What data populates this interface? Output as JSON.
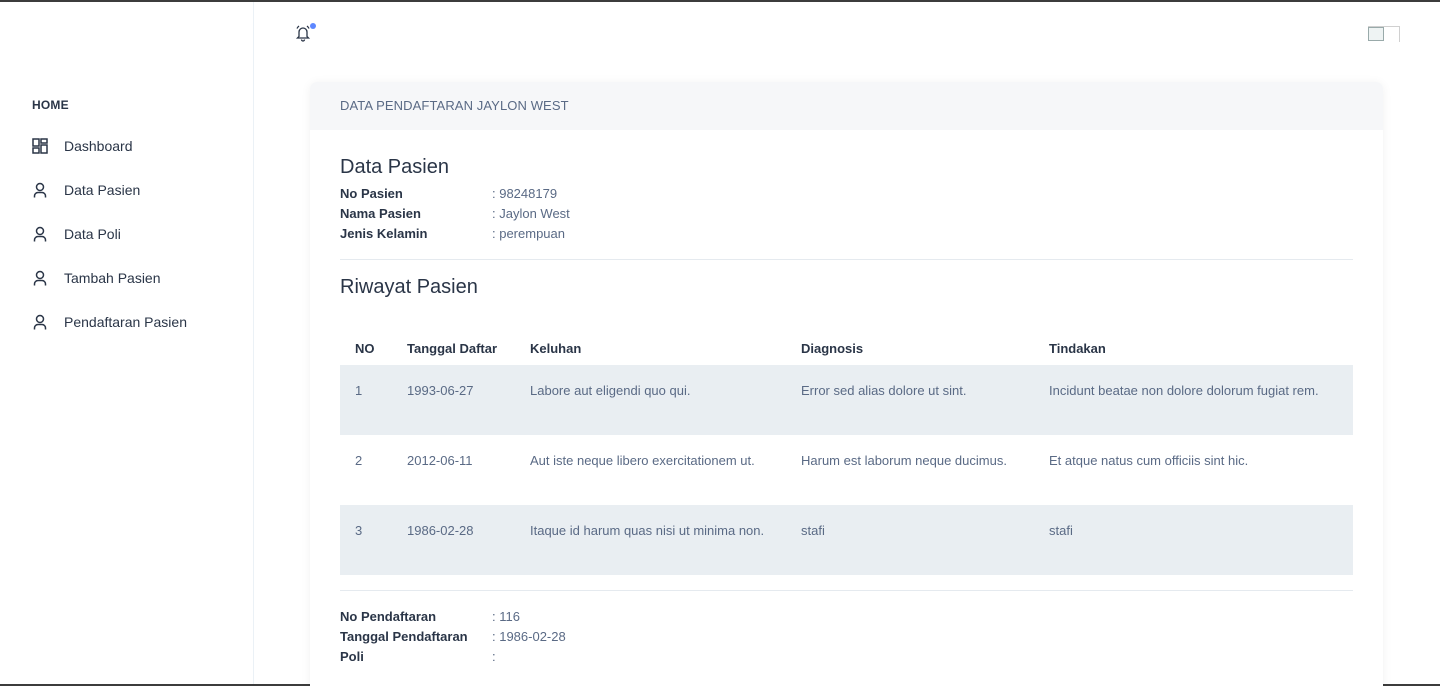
{
  "sidebar": {
    "caption": "HOME",
    "items": [
      {
        "label": "Dashboard",
        "icon": "layout-dashboard-icon"
      },
      {
        "label": "Data Pasien",
        "icon": "user-icon"
      },
      {
        "label": "Data Poli",
        "icon": "user-icon"
      },
      {
        "label": "Tambah Pasien",
        "icon": "user-icon"
      },
      {
        "label": "Pendaftaran Pasien",
        "icon": "user-icon"
      }
    ]
  },
  "topbar": {
    "bell_icon": "bell-ringing-icon",
    "notification_dot_color": "#5d87ff"
  },
  "card": {
    "header": "DATA PENDAFTARAN JAYLON WEST",
    "patient_title": "Data Pasien",
    "patient": [
      {
        "key": "No Pasien",
        "value": ": 98248179"
      },
      {
        "key": "Nama Pasien",
        "value": ": Jaylon West"
      },
      {
        "key": "Jenis Kelamin",
        "value": ": perempuan"
      }
    ],
    "history_title": "Riwayat Pasien",
    "table": {
      "headers": {
        "no": "NO",
        "tanggal": "Tanggal Daftar",
        "keluhan": "Keluhan",
        "diagnosis": "Diagnosis",
        "tindakan": "Tindakan"
      },
      "rows": [
        {
          "no": "1",
          "tanggal": "1993-06-27",
          "keluhan": "Labore aut eligendi quo qui.",
          "diagnosis": "Error sed alias dolore ut sint.",
          "tindakan": "Incidunt beatae non dolore dolorum fugiat rem."
        },
        {
          "no": "2",
          "tanggal": "2012-06-11",
          "keluhan": "Aut iste neque libero exercitationem ut.",
          "diagnosis": "Harum est laborum neque ducimus.",
          "tindakan": "Et atque natus cum officiis sint hic."
        },
        {
          "no": "3",
          "tanggal": "1986-02-28",
          "keluhan": "Itaque id harum quas nisi ut minima non.",
          "diagnosis": "stafi",
          "tindakan": "stafi"
        }
      ]
    },
    "registration": [
      {
        "key": "No Pendaftaran",
        "value": ": 116"
      },
      {
        "key": "Tanggal Pendaftaran",
        "value": ": 1986-02-28"
      },
      {
        "key": "Poli",
        "value": ":"
      }
    ]
  }
}
